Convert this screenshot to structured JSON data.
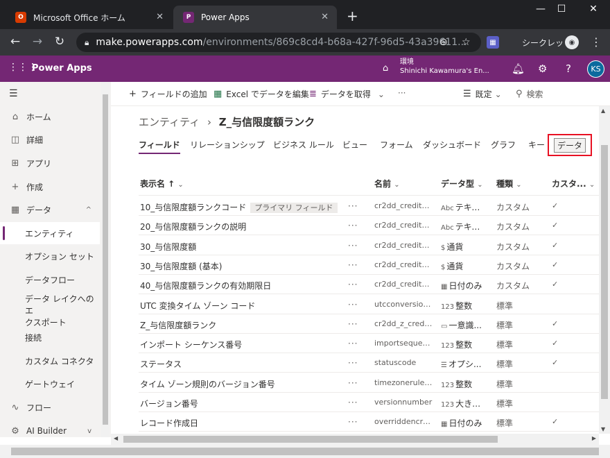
{
  "browser": {
    "tabs": [
      {
        "title": "Microsoft Office ホーム",
        "favicon": "O"
      },
      {
        "title": "Power Apps",
        "favicon": "P"
      }
    ],
    "url_host": "make.powerapps.com",
    "url_path": "/environments/869c8cd4-b68a-427f-96d5-43a39611...",
    "incognito_label": "シークレット"
  },
  "app": {
    "name": "Power Apps",
    "env_label": "環境",
    "env_name": "Shinichi Kawamura's En...",
    "user_initials": "KS"
  },
  "sidebar": {
    "items": [
      {
        "label": "ホーム",
        "icon": "home-icon",
        "glyph": "⌂"
      },
      {
        "label": "詳細",
        "icon": "book-icon",
        "glyph": "◫"
      },
      {
        "label": "アプリ",
        "icon": "apps-icon",
        "glyph": "⊞"
      },
      {
        "label": "作成",
        "icon": "plus-icon",
        "glyph": "+"
      },
      {
        "label": "データ",
        "icon": "table-icon",
        "glyph": "▦",
        "chevron": "^"
      },
      {
        "label": "エンティティ",
        "sub": true,
        "selected": true
      },
      {
        "label": "オプション セット",
        "sub": true
      },
      {
        "label": "データフロー",
        "sub": true
      },
      {
        "label": "データ レイクへのエ",
        "label2": "クスポート",
        "sub": true
      },
      {
        "label": "接続",
        "sub": true
      },
      {
        "label": "カスタム コネクタ",
        "sub": true
      },
      {
        "label": "ゲートウェイ",
        "sub": true
      },
      {
        "label": "フロー",
        "icon": "flow-icon",
        "glyph": "∿"
      },
      {
        "label": "AI Builder",
        "icon": "ai-builder-icon",
        "glyph": "⚙",
        "chevron": "v"
      }
    ]
  },
  "commands": {
    "add_field": "フィールドの追加",
    "excel_edit": "Excel でデータを編集",
    "get_data": "データを取得",
    "overflow": "···",
    "settings": "既定",
    "search": "検索"
  },
  "breadcrumb": {
    "root": "エンティティ",
    "current": "Z_与信限度額ランク"
  },
  "page_tabs": [
    {
      "label": "フィールド",
      "active": true
    },
    {
      "label": "リレーションシップ"
    },
    {
      "label": "ビジネス ルール"
    },
    {
      "label": "ビュー"
    },
    {
      "label": "フォーム"
    },
    {
      "label": "ダッシュボード"
    },
    {
      "label": "グラフ"
    },
    {
      "label": "キー"
    }
  ],
  "data_tab": "データ",
  "table": {
    "columns": {
      "display_name": "表示名 ↑",
      "name": "名前",
      "data_type": "データ型",
      "kind": "種類",
      "custom": "カスタ..."
    },
    "rows": [
      {
        "display": "10_与信限度額ランクコード",
        "badge": "プライマリ フィールド",
        "name": "cr2dd_credit_li...",
        "type_icon": "Abc",
        "type": "テキスト",
        "kind": "カスタム",
        "custom": "✓"
      },
      {
        "display": "20_与信限度額ランクの説明",
        "name": "cr2dd_credit_li...",
        "type_icon": "Abc",
        "type": "テキスト",
        "kind": "カスタム",
        "custom": "✓"
      },
      {
        "display": "30_与信限度額",
        "name": "cr2dd_credit_li...",
        "type_icon": "$",
        "type": "通貨",
        "kind": "カスタム",
        "custom": "✓"
      },
      {
        "display": "30_与信限度額 (基本)",
        "name": "cr2dd_credit_li...",
        "type_icon": "$",
        "type": "通貨",
        "kind": "カスタム",
        "custom": "✓"
      },
      {
        "display": "40_与信限度額ランクの有効期限日",
        "name": "cr2dd_credit_li...",
        "type_icon": "▦",
        "type": "日付のみ",
        "kind": "カスタム",
        "custom": "✓"
      },
      {
        "display": "UTC 変換タイム ゾーン コード",
        "name": "utcconversion...",
        "type_icon": "123",
        "type": "整数",
        "kind": "標準",
        "custom": ""
      },
      {
        "display": "Z_与信限度額ランク",
        "name": "cr2dd_z_credit...",
        "type_icon": "▭",
        "type": "一意識...",
        "kind": "標準",
        "custom": "✓"
      },
      {
        "display": "インポート シーケンス番号",
        "name": "importsequen...",
        "type_icon": "123",
        "type": "整数",
        "kind": "標準",
        "custom": "✓"
      },
      {
        "display": "ステータス",
        "name": "statuscode",
        "type_icon": "☰",
        "type": "オプシ...",
        "kind": "標準",
        "custom": "✓"
      },
      {
        "display": "タイム ゾーン規則のバージョン番号",
        "name": "timezonerulev...",
        "type_icon": "123",
        "type": "整数",
        "kind": "標準",
        "custom": ""
      },
      {
        "display": "バージョン番号",
        "name": "versionnumber",
        "type_icon": "123",
        "type": "大きい...",
        "kind": "標準",
        "custom": ""
      },
      {
        "display": "レコード作成日",
        "name": "overriddencre...",
        "type_icon": "▦",
        "type": "日付のみ",
        "kind": "標準",
        "custom": "✓"
      }
    ]
  },
  "colors": {
    "brand": "#742774",
    "highlight_box": "#e81123"
  }
}
